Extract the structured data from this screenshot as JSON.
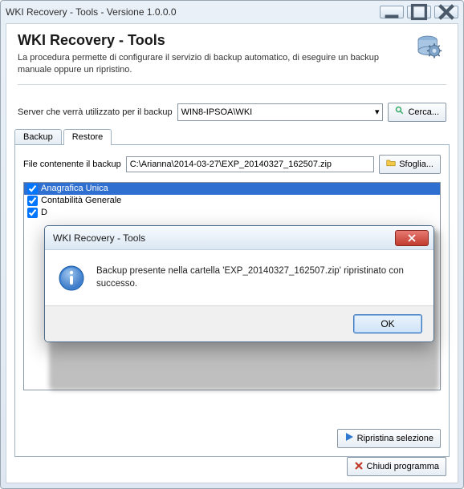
{
  "window": {
    "title": "WKI Recovery - Tools - Versione 1.0.0.0"
  },
  "header": {
    "title": "WKI Recovery - Tools",
    "subtitle": "La procedura permette di configurare il servizio di backup automatico, di eseguire un backup manuale oppure un ripristino."
  },
  "server": {
    "label": "Server che verrà utilizzato per il backup",
    "value": "WIN8-IPSOA\\WKI",
    "search_label": "Cerca..."
  },
  "tabs": {
    "backup": "Backup",
    "restore": "Restore"
  },
  "file": {
    "label": "File contenente il backup",
    "value": "C:\\Arianna\\2014-03-27\\EXP_20140327_162507.zip",
    "browse_label": "Sfoglia..."
  },
  "list": {
    "items": [
      {
        "label": "Anagrafica Unica",
        "checked": true,
        "selected": true
      },
      {
        "label": "Contabilità Generale",
        "checked": true,
        "selected": false
      },
      {
        "label": "D",
        "checked": true,
        "selected": false
      }
    ]
  },
  "actions": {
    "restore_selection": "Ripristina selezione",
    "close_program": "Chiudi programma"
  },
  "dialog": {
    "title": "WKI Recovery - Tools",
    "message": "Backup presente nella cartella 'EXP_20140327_162507.zip' ripristinato con successo.",
    "ok": "OK"
  }
}
